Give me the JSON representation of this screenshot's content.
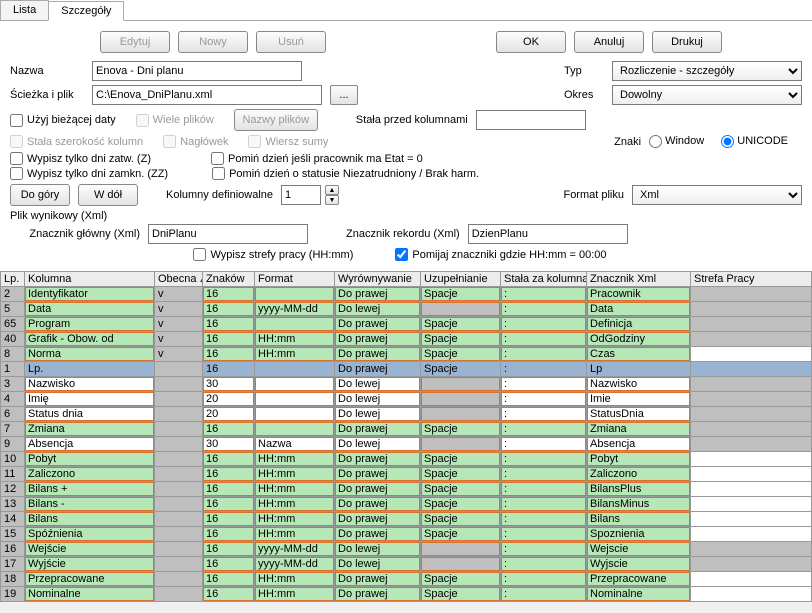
{
  "tabs": {
    "list": "Lista",
    "details": "Szczegóły"
  },
  "buttons": {
    "edit": "Edytuj",
    "new": "Nowy",
    "delete": "Usuń",
    "ok": "OK",
    "cancel": "Anuluj",
    "print": "Drukuj",
    "browse": "...",
    "filenames": "Nazwy plików",
    "up": "Do góry",
    "down": "W dół"
  },
  "labels": {
    "name": "Nazwa",
    "path": "Ścieżka i plik",
    "type": "Typ",
    "period": "Okres",
    "use_current_date": "Użyj bieżącej daty",
    "many_files": "Wiele plików",
    "const_before_cols": "Stała przed kolumnami",
    "fixed_width": "Stała szerokość kolumn",
    "header": "Nagłówek",
    "sum_row": "Wiersz sumy",
    "chars": "Znaki",
    "window": "Window",
    "unicode": "UNICODE",
    "only_approved": "Wypisz tylko dni zatw. (Z)",
    "only_closed": "Wypisz tylko dni zamkn. (ZZ)",
    "skip_etat0": "Pomiń dzień jeśli pracownik ma Etat = 0",
    "skip_unemployed": "Pomiń dzień o statusie Niezatrudniony / Brak harm.",
    "def_cols": "Kolumny definiowalne",
    "file_format": "Format pliku",
    "result_file": "Plik wynikowy (Xml)",
    "main_tag": "Znacznik główny (Xml)",
    "record_tag": "Znacznik rekordu (Xml)",
    "print_zones": "Wypisz strefy pracy (HH:mm)",
    "skip_zero": "Pomijaj znaczniki gdzie HH:mm = 00:00"
  },
  "values": {
    "name": "Enova - Dni planu",
    "path": "C:\\Enova_DniPlanu.xml",
    "type": "Rozliczenie - szczegóły",
    "period": "Dowolny",
    "const_before_cols": "",
    "chars": "UNICODE",
    "def_cols": "1",
    "file_format": "Xml",
    "main_tag": "DniPlanu",
    "record_tag": "DzienPlanu"
  },
  "grid": {
    "headers": {
      "lp": "Lp.",
      "kolumna": "Kolumna",
      "obecna": "Obecna",
      "znakow": "Znaków",
      "format": "Format",
      "wyrownywanie": "Wyrównywanie",
      "uzupelnianie": "Uzupełnianie",
      "stala_za": "Stała za kolumną",
      "znacznik_xml": "Znacznik Xml",
      "strefa": "Strefa Pracy"
    },
    "rows": [
      {
        "lp": "2",
        "kol": "Identyfikator",
        "ob": "v",
        "zn": "16",
        "fmt": "",
        "wy": "Do prawej",
        "uz": "Spacje",
        "st": ":",
        "zx": "Pracownik",
        "g": true,
        "uz_g": false,
        "sp_g": true
      },
      {
        "lp": "5",
        "kol": "Data",
        "ob": "v",
        "zn": "16",
        "fmt": "yyyy-MM-dd",
        "wy": "Do lewej",
        "uz": "",
        "st": ":",
        "zx": "Data",
        "g": true,
        "uz_g": true,
        "sp_g": true
      },
      {
        "lp": "65",
        "kol": "Program",
        "ob": "v",
        "zn": "16",
        "fmt": "",
        "wy": "Do prawej",
        "uz": "Spacje",
        "st": ":",
        "zx": "Definicja",
        "g": true,
        "uz_g": false,
        "sp_g": true
      },
      {
        "lp": "40",
        "kol": "Grafik - Obow. od",
        "ob": "v",
        "zn": "16",
        "fmt": "HH:mm",
        "wy": "Do prawej",
        "uz": "Spacje",
        "st": ":",
        "zx": "OdGodziny",
        "g": true,
        "uz_g": false,
        "sp_g": true
      },
      {
        "lp": "8",
        "kol": "Norma",
        "ob": "v",
        "zn": "16",
        "fmt": "HH:mm",
        "wy": "Do prawej",
        "uz": "Spacje",
        "st": ":",
        "zx": "Czas",
        "g": true,
        "uz_g": false,
        "sp_w": true
      },
      {
        "lp": "1",
        "kol": "Lp.",
        "ob": "",
        "zn": "16",
        "fmt": "",
        "wy": "Do prawej",
        "uz": "Spacje",
        "st": ":",
        "zx": "Lp",
        "sel": true
      },
      {
        "lp": "3",
        "kol": "Nazwisko",
        "ob": "",
        "zn": "30",
        "fmt": "",
        "wy": "Do lewej",
        "uz": "",
        "st": ":",
        "zx": "Nazwisko",
        "g": false,
        "uz_g": true,
        "sp_g": true
      },
      {
        "lp": "4",
        "kol": "Imię",
        "ob": "",
        "zn": "20",
        "fmt": "",
        "wy": "Do lewej",
        "uz": "",
        "st": ":",
        "zx": "Imie",
        "g": false,
        "uz_g": true,
        "sp_g": true
      },
      {
        "lp": "6",
        "kol": "Status dnia",
        "ob": "",
        "zn": "20",
        "fmt": "",
        "wy": "Do lewej",
        "uz": "",
        "st": ":",
        "zx": "StatusDnia",
        "g": false,
        "uz_g": true,
        "sp_g": true
      },
      {
        "lp": "7",
        "kol": "Zmiana",
        "ob": "",
        "zn": "16",
        "fmt": "",
        "wy": "Do prawej",
        "uz": "Spacje",
        "st": ":",
        "zx": "Zmiana",
        "g": true,
        "uz_g": false,
        "sp_g": true
      },
      {
        "lp": "9",
        "kol": "Absencja",
        "ob": "",
        "zn": "30",
        "fmt": "Nazwa",
        "wy": "Do lewej",
        "uz": "",
        "st": ":",
        "zx": "Absencja",
        "g": false,
        "uz_g": true,
        "sp_g": true
      },
      {
        "lp": "10",
        "kol": "Pobyt",
        "ob": "",
        "zn": "16",
        "fmt": "HH:mm",
        "wy": "Do prawej",
        "uz": "Spacje",
        "st": ":",
        "zx": "Pobyt",
        "g": true,
        "uz_g": false,
        "sp_w": true
      },
      {
        "lp": "11",
        "kol": "Zaliczono",
        "ob": "",
        "zn": "16",
        "fmt": "HH:mm",
        "wy": "Do prawej",
        "uz": "Spacje",
        "st": ":",
        "zx": "Zaliczono",
        "g": true,
        "uz_g": false,
        "sp_w": true
      },
      {
        "lp": "12",
        "kol": "Bilans +",
        "ob": "",
        "zn": "16",
        "fmt": "HH:mm",
        "wy": "Do prawej",
        "uz": "Spacje",
        "st": ":",
        "zx": "BilansPlus",
        "g": true,
        "uz_g": false,
        "sp_w": true
      },
      {
        "lp": "13",
        "kol": "Bilans -",
        "ob": "",
        "zn": "16",
        "fmt": "HH:mm",
        "wy": "Do prawej",
        "uz": "Spacje",
        "st": ":",
        "zx": "BilansMinus",
        "g": true,
        "uz_g": false,
        "sp_w": true
      },
      {
        "lp": "14",
        "kol": "Bilans",
        "ob": "",
        "zn": "16",
        "fmt": "HH:mm",
        "wy": "Do prawej",
        "uz": "Spacje",
        "st": ":",
        "zx": "Bilans",
        "g": true,
        "uz_g": false,
        "sp_w": true
      },
      {
        "lp": "15",
        "kol": "Spóźnienia",
        "ob": "",
        "zn": "16",
        "fmt": "HH:mm",
        "wy": "Do prawej",
        "uz": "Spacje",
        "st": ":",
        "zx": "Spoznienia",
        "g": true,
        "uz_g": false,
        "sp_w": true
      },
      {
        "lp": "16",
        "kol": "Wejście",
        "ob": "",
        "zn": "16",
        "fmt": "yyyy-MM-dd",
        "wy": "Do lewej",
        "uz": "",
        "st": ":",
        "zx": "Wejscie",
        "g": true,
        "uz_g": true,
        "sp_g": true
      },
      {
        "lp": "17",
        "kol": "Wyjście",
        "ob": "",
        "zn": "16",
        "fmt": "yyyy-MM-dd",
        "wy": "Do lewej",
        "uz": "",
        "st": ":",
        "zx": "Wyjscie",
        "g": true,
        "uz_g": true,
        "sp_g": true
      },
      {
        "lp": "18",
        "kol": "Przepracowane",
        "ob": "",
        "zn": "16",
        "fmt": "HH:mm",
        "wy": "Do prawej",
        "uz": "Spacje",
        "st": ":",
        "zx": "Przepracowane",
        "g": true,
        "uz_g": false,
        "sp_w": true
      },
      {
        "lp": "19",
        "kol": "Nominalne",
        "ob": "",
        "zn": "16",
        "fmt": "HH:mm",
        "wy": "Do prawej",
        "uz": "Spacje",
        "st": ":",
        "zx": "Nominalne",
        "g": true,
        "uz_g": false,
        "sp_w": true
      }
    ]
  }
}
